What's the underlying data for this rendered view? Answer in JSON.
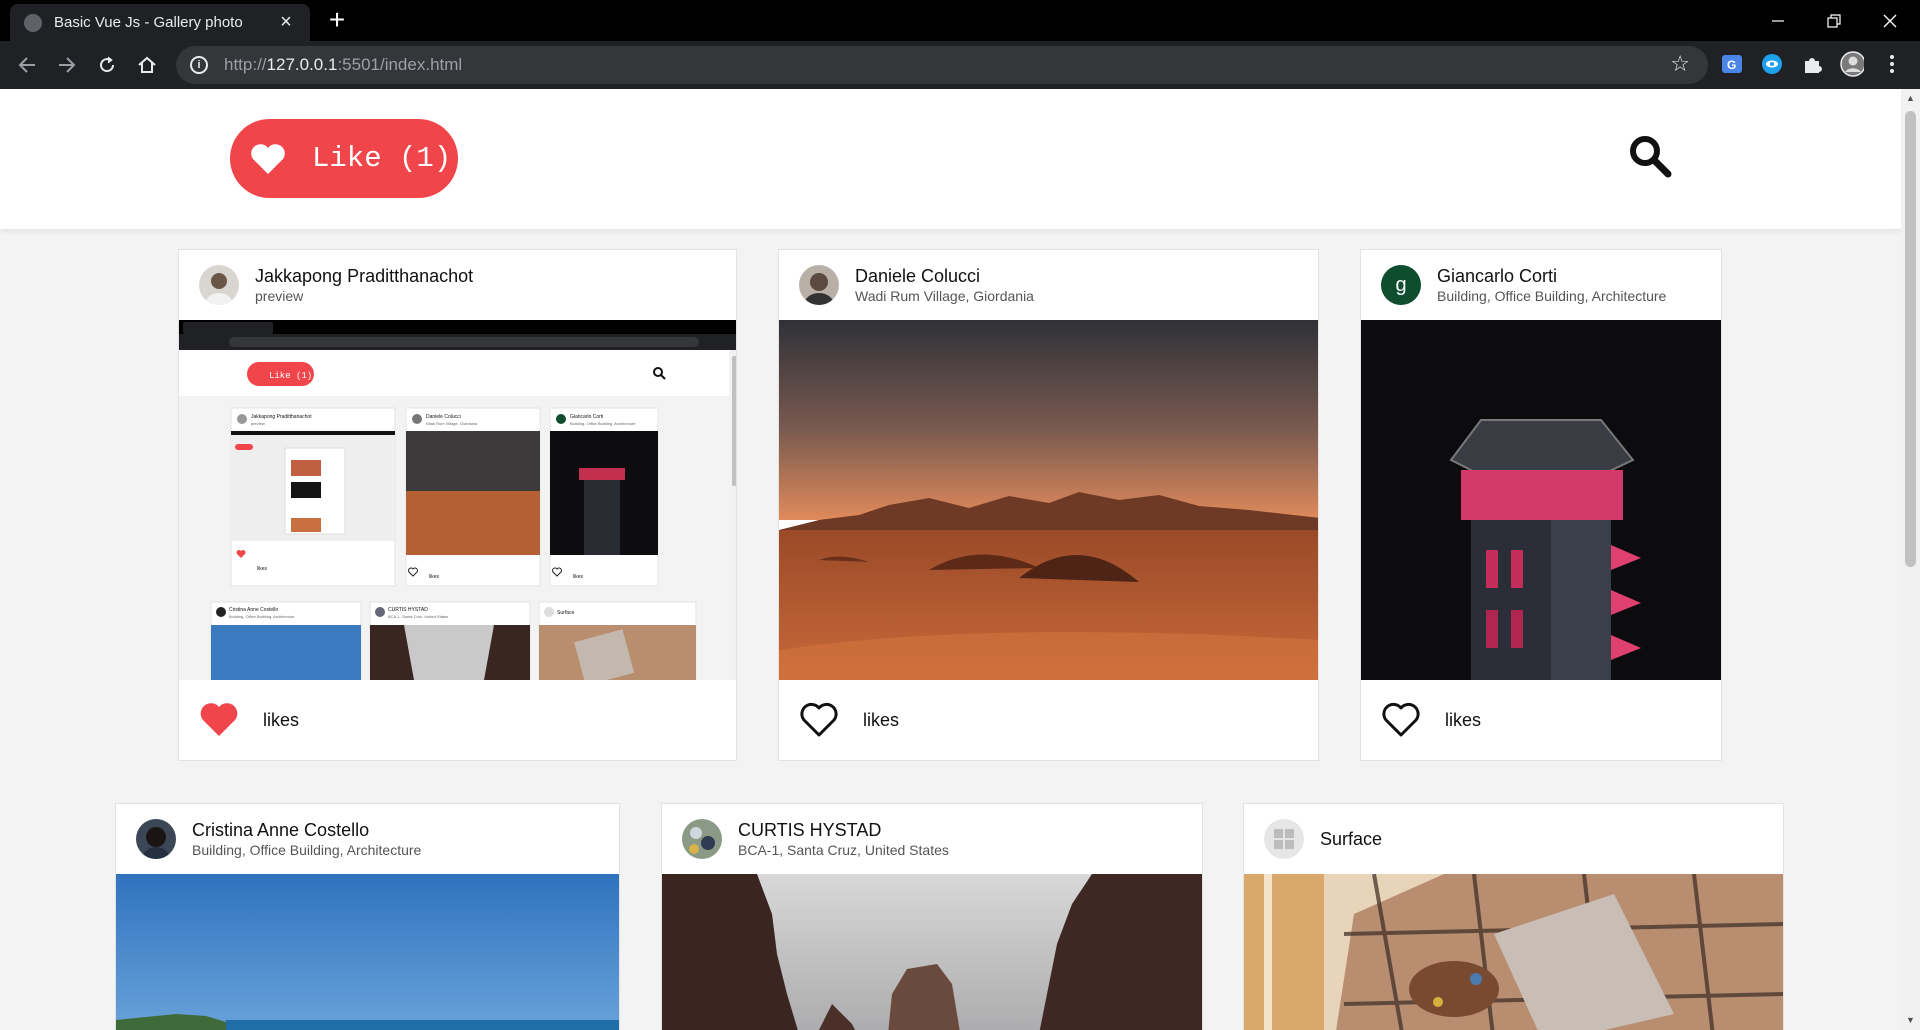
{
  "browser": {
    "tab_title": "Basic Vue Js - Gallery photo",
    "url_scheme": "http://",
    "url_host": "127.0.0.1",
    "url_rest": ":5501/index.html"
  },
  "header": {
    "like_label": "Like (1)"
  },
  "cards": [
    {
      "user": "Jakkapong Praditthanachot",
      "location": "preview",
      "likes_label": "likes",
      "liked": true
    },
    {
      "user": "Daniele Colucci",
      "location": "Wadi Rum Village, Giordania",
      "likes_label": "likes",
      "liked": false
    },
    {
      "user": "Giancarlo Corti",
      "location": "Building, Office Building, Architecture",
      "likes_label": "likes",
      "liked": false,
      "avatar_letter": "g"
    },
    {
      "user": "Cristina Anne Costello",
      "location": "Building, Office Building, Architecture"
    },
    {
      "user": "CURTIS HYSTAD",
      "location": "BCA-1, Santa Cruz, United States"
    },
    {
      "user": "Surface",
      "location": ""
    }
  ],
  "preview": {
    "like_label": "Like (1)",
    "cards": [
      {
        "user": "Jakkapong Praditthanachot",
        "location": "preview",
        "likes_label": "likes"
      },
      {
        "user": "Daniele Colucci",
        "location": "Wadi Rum Village, Giordania",
        "likes_label": "likes"
      },
      {
        "user": "Giancarlo Corti",
        "location": "Building, Office Building, Architecture",
        "likes_label": "likes"
      },
      {
        "user": "Cristina Anne Costello",
        "location": "Building, Office Building, Architecture"
      },
      {
        "user": "CURTIS HYSTAD",
        "location": "BCA-1, Santa Cruz, United States"
      },
      {
        "user": "Surface",
        "location": ""
      }
    ]
  },
  "colors": {
    "accent": "#f0454a",
    "chrome_dark": "#202124"
  }
}
